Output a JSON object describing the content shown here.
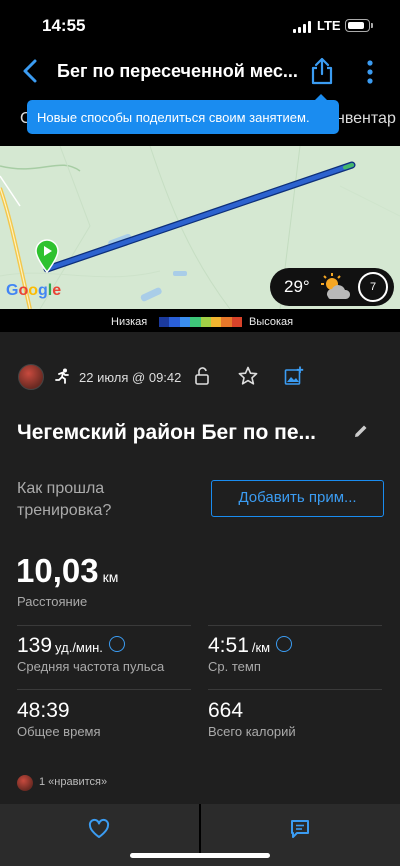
{
  "status_bar": {
    "time": "14:55",
    "network": "LTE"
  },
  "header": {
    "title": "Бег по пересеченной мес...",
    "icons": {
      "back": "chevron-left-icon",
      "share": "share-icon",
      "more": "more-vertical-icon"
    }
  },
  "tabs": {
    "left_partial": "С",
    "right_partial": "нвентар"
  },
  "tooltip": {
    "text": "Новые способы поделиться своим занятием."
  },
  "map": {
    "logo": "Google",
    "weather": {
      "temp": "29°",
      "icon": "partly-sunny-icon",
      "wind": "7"
    },
    "route_color_low": "#1b4fb8",
    "start_marker_color": "#2fc22f"
  },
  "legend": {
    "low": "Низкая",
    "high": "Высокая",
    "colors": [
      "#1b3a9e",
      "#2a5fd8",
      "#3b8ff0",
      "#3ec77a",
      "#a2d046",
      "#f2b530",
      "#e8782a",
      "#d9432a"
    ]
  },
  "activity": {
    "date": "22 июля @ 09:42",
    "name": "Чегемский район Бег по пе...",
    "question": "Как прошла тренировка?",
    "add_note": "Добавить прим...",
    "distance": {
      "value": "10,03",
      "unit": "км",
      "label": "Расстояние"
    },
    "stats": [
      {
        "value": "139",
        "unit": "уд./мин.",
        "label": "Средняя частота пульса"
      },
      {
        "value": "4:51",
        "unit": "/км",
        "label": "Ср. темп"
      },
      {
        "value": "48:39",
        "unit": "",
        "label": "Общее время"
      },
      {
        "value": "664",
        "unit": "",
        "label": "Всего калорий"
      }
    ],
    "likes": "1 «нравится»"
  },
  "bottom_bar": {
    "left_icon": "heart-icon",
    "right_icon": "comment-icon"
  },
  "colors": {
    "accent": "#1a8cf0",
    "background": "#1f1f1f"
  }
}
